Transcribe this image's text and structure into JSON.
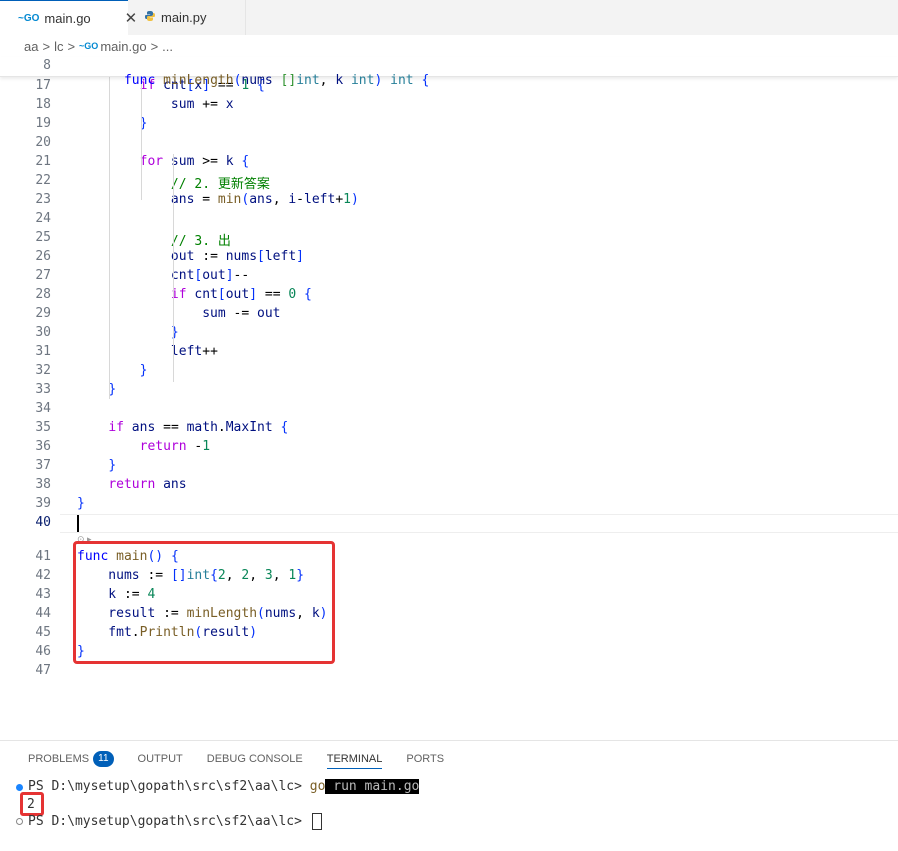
{
  "tabs": [
    {
      "label": "main.go",
      "icon": "go-file-icon",
      "active": true
    },
    {
      "label": "main.py",
      "icon": "python-file-icon",
      "active": false
    }
  ],
  "tab_close_glyph": "✕",
  "go_icon_text": "~GO",
  "breadcrumb": {
    "parts": [
      "aa",
      "lc",
      "main.go",
      "..."
    ],
    "sep": ">"
  },
  "sticky": {
    "line": "8",
    "code": "func minLength(nums []int, k int) int {"
  },
  "lines": [
    {
      "n": "17",
      "text": "        if cnt[x] == 1 {"
    },
    {
      "n": "18",
      "text": "            sum += x"
    },
    {
      "n": "19",
      "text": "        }"
    },
    {
      "n": "20",
      "text": ""
    },
    {
      "n": "21",
      "text": "        for sum >= k {"
    },
    {
      "n": "22",
      "text": "            // 2. 更新答案"
    },
    {
      "n": "23",
      "text": "            ans = min(ans, i-left+1)"
    },
    {
      "n": "24",
      "text": ""
    },
    {
      "n": "25",
      "text": "            // 3. 出"
    },
    {
      "n": "26",
      "text": "            out := nums[left]"
    },
    {
      "n": "27",
      "text": "            cnt[out]--"
    },
    {
      "n": "28",
      "text": "            if cnt[out] == 0 {"
    },
    {
      "n": "29",
      "text": "                sum -= out"
    },
    {
      "n": "30",
      "text": "            }"
    },
    {
      "n": "31",
      "text": "            left++"
    },
    {
      "n": "32",
      "text": "        }"
    },
    {
      "n": "33",
      "text": "    }"
    },
    {
      "n": "34",
      "text": ""
    },
    {
      "n": "35",
      "text": "    if ans == math.MaxInt {"
    },
    {
      "n": "36",
      "text": "        return -1"
    },
    {
      "n": "37",
      "text": "    }"
    },
    {
      "n": "38",
      "text": "    return ans"
    },
    {
      "n": "39",
      "text": "}"
    },
    {
      "n": "40",
      "text": ""
    },
    {
      "n": "41",
      "text": "func main() {"
    },
    {
      "n": "42",
      "text": "    nums := []int{2, 2, 3, 1}"
    },
    {
      "n": "43",
      "text": "    k := 4"
    },
    {
      "n": "44",
      "text": "    result := minLength(nums, k)"
    },
    {
      "n": "45",
      "text": "    fmt.Println(result)"
    },
    {
      "n": "46",
      "text": "}"
    },
    {
      "n": "47",
      "text": ""
    }
  ],
  "panel": {
    "tabs": [
      "PROBLEMS",
      "OUTPUT",
      "DEBUG CONSOLE",
      "TERMINAL",
      "PORTS"
    ],
    "active_tab": "TERMINAL",
    "problems_count": "11",
    "terminal": {
      "prompt1": "PS D:\\mysetup\\gopath\\src\\sf2\\aa\\lc> ",
      "cmd_go": "go",
      "cmd_rest": " run main.go",
      "output": "2",
      "prompt2": "PS D:\\mysetup\\gopath\\src\\sf2\\aa\\lc> "
    }
  },
  "colors": {
    "accent": "#005fb8",
    "highlight_box": "#e53333"
  }
}
